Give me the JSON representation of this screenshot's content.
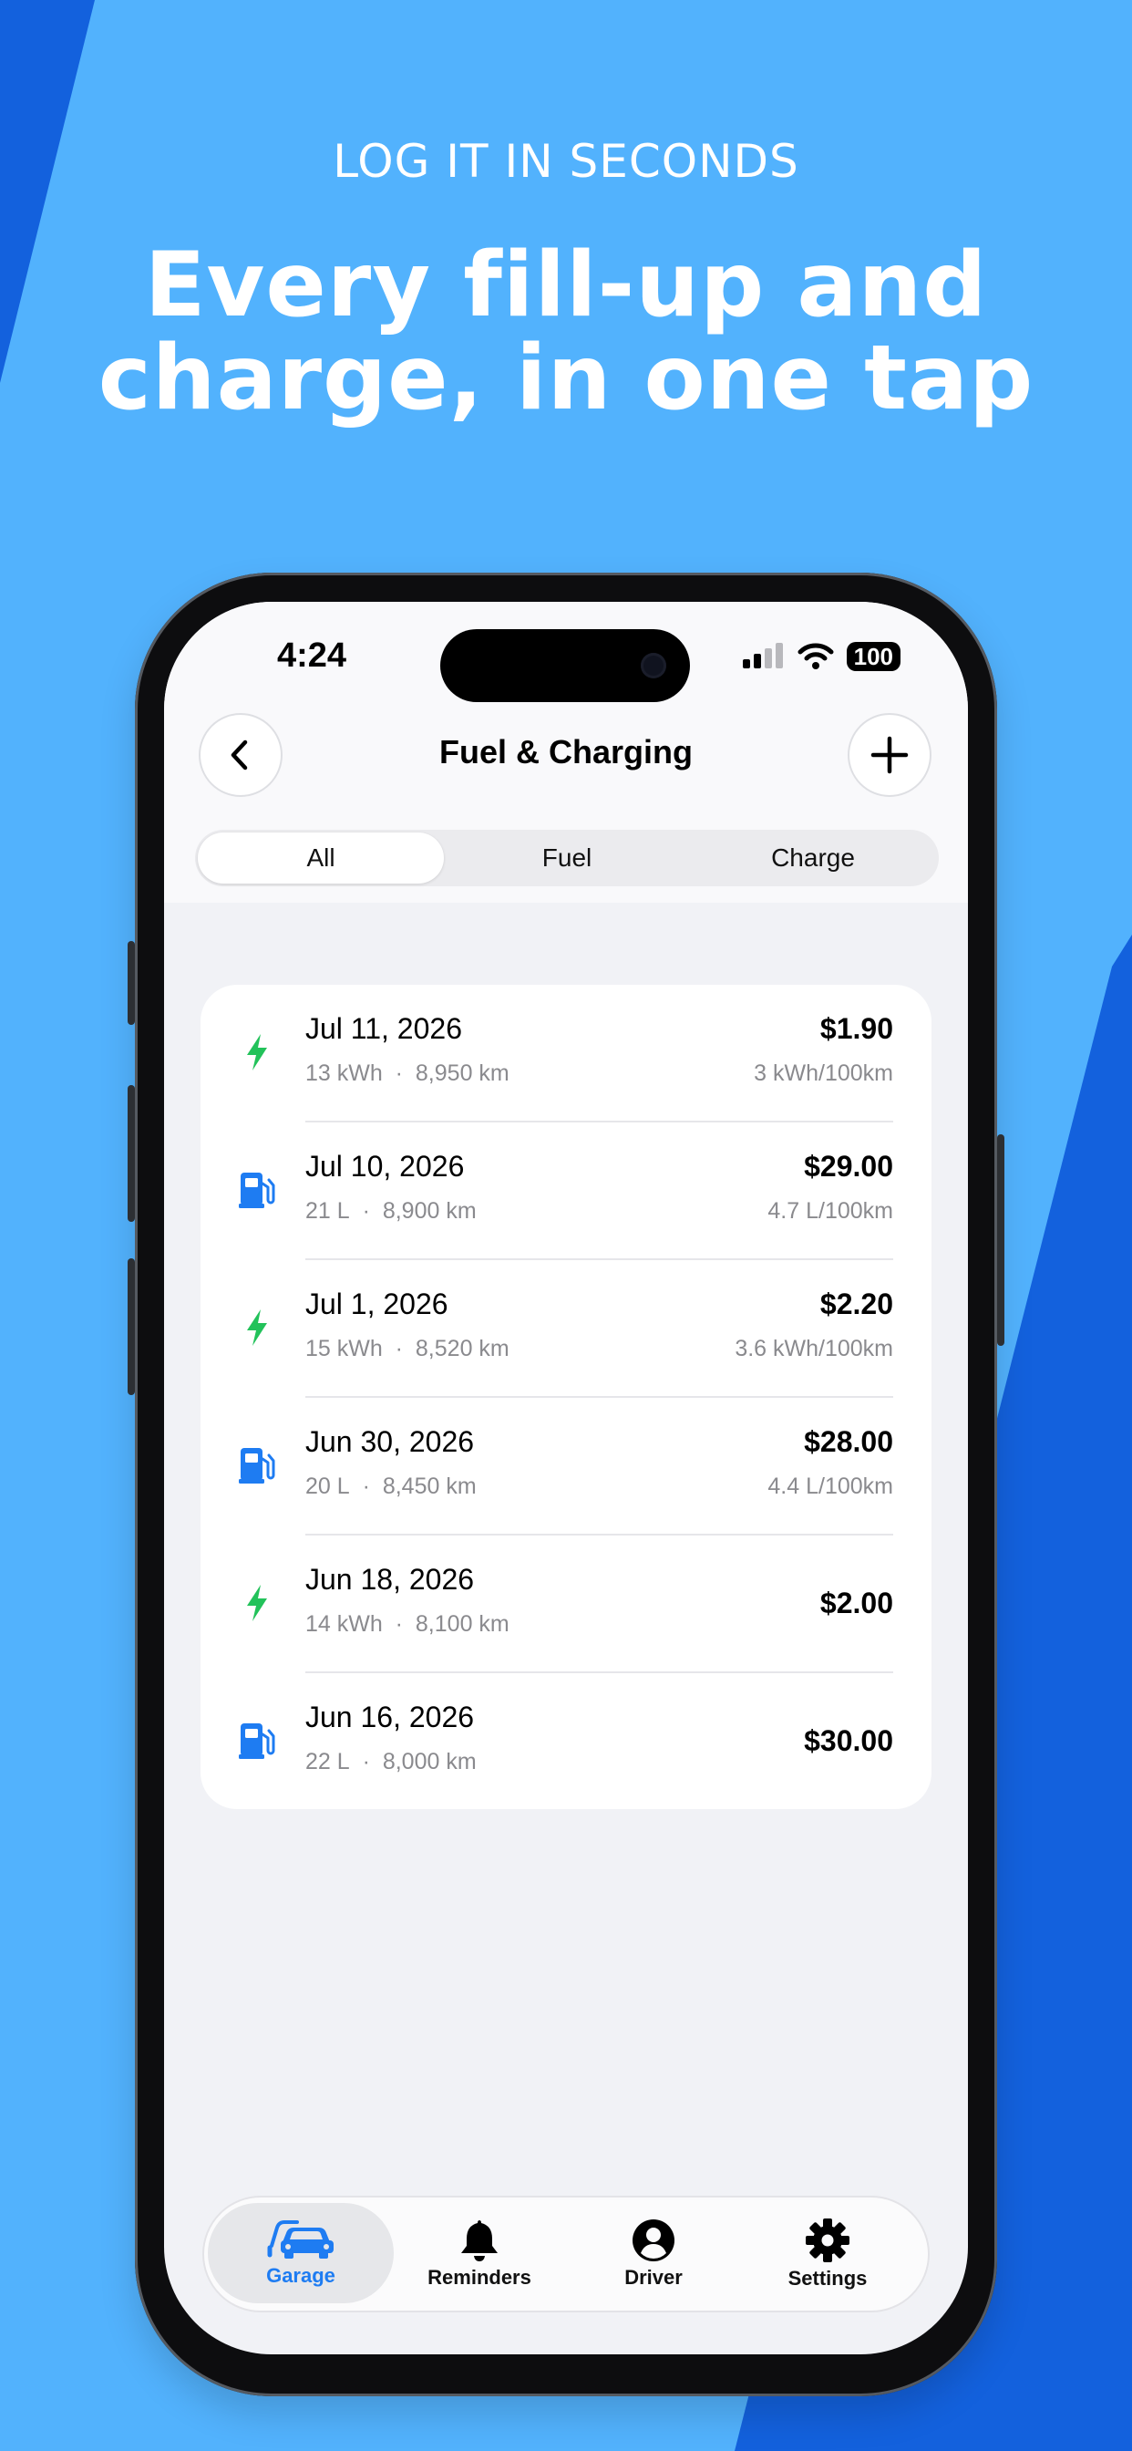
{
  "colors": {
    "background": "#52b2fd",
    "accent_dark": "#1361dd",
    "charge_green": "#22c25a",
    "fuel_blue": "#1e7cf2"
  },
  "marketing": {
    "kicker": "LOG IT IN SECONDS",
    "headline_line1": "Every fill-up and",
    "headline_line2": "charge, in one tap"
  },
  "status_bar": {
    "time": "4:24",
    "battery": "100"
  },
  "nav": {
    "back_icon": "chevron-left-icon",
    "title": "Fuel & Charging",
    "add_icon": "plus-icon"
  },
  "filter": {
    "segments": [
      "All",
      "Fuel",
      "Charge"
    ],
    "selected": "All"
  },
  "entries": [
    {
      "type": "charge",
      "icon": "bolt-icon",
      "date": "Jul 11, 2026",
      "amount": "13 kWh",
      "odometer": "8,950 km",
      "price": "$1.90",
      "efficiency": "3 kWh/100km"
    },
    {
      "type": "fuel",
      "icon": "fuel-pump-icon",
      "date": "Jul 10, 2026",
      "amount": "21 L",
      "odometer": "8,900 km",
      "price": "$29.00",
      "efficiency": "4.7 L/100km"
    },
    {
      "type": "charge",
      "icon": "bolt-icon",
      "date": "Jul 1, 2026",
      "amount": "15 kWh",
      "odometer": "8,520 km",
      "price": "$2.20",
      "efficiency": "3.6 kWh/100km"
    },
    {
      "type": "fuel",
      "icon": "fuel-pump-icon",
      "date": "Jun 30, 2026",
      "amount": "20 L",
      "odometer": "8,450 km",
      "price": "$28.00",
      "efficiency": "4.4 L/100km"
    },
    {
      "type": "charge",
      "icon": "bolt-icon",
      "date": "Jun 18, 2026",
      "amount": "14 kWh",
      "odometer": "8,100 km",
      "price": "$2.00",
      "efficiency": ""
    },
    {
      "type": "fuel",
      "icon": "fuel-pump-icon",
      "date": "Jun 16, 2026",
      "amount": "22 L",
      "odometer": "8,000 km",
      "price": "$30.00",
      "efficiency": ""
    }
  ],
  "meta_separator": "·",
  "tabbar": {
    "items": [
      {
        "label": "Garage",
        "icon": "cars-icon",
        "active": true
      },
      {
        "label": "Reminders",
        "icon": "bell-icon",
        "active": false
      },
      {
        "label": "Driver",
        "icon": "person-icon",
        "active": false
      },
      {
        "label": "Settings",
        "icon": "gear-icon",
        "active": false
      }
    ]
  }
}
